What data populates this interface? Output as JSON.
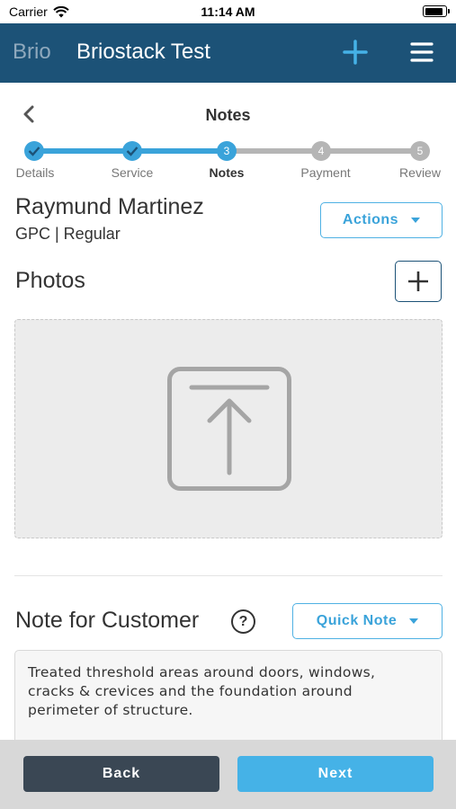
{
  "status_bar": {
    "carrier": "Carrier",
    "time": "11:14 AM",
    "battery_level": 0.9
  },
  "header": {
    "brand": "Brio",
    "title": "Briostack Test",
    "add_icon": "plus-icon",
    "menu_icon": "hamburger-icon"
  },
  "wizard": {
    "title": "Notes",
    "back_icon": "chevron-left-icon",
    "steps": [
      {
        "label": "Details",
        "state": "done"
      },
      {
        "label": "Service",
        "state": "done"
      },
      {
        "label": "Notes",
        "number": "3",
        "state": "active"
      },
      {
        "label": "Payment",
        "number": "4",
        "state": "pending"
      },
      {
        "label": "Review",
        "number": "5",
        "state": "pending"
      }
    ]
  },
  "customer": {
    "name": "Raymund Martinez",
    "subtitle": "GPC | Regular",
    "actions_label": "Actions"
  },
  "photos": {
    "title": "Photos",
    "add_icon": "plus-icon",
    "upload_icon": "upload-icon"
  },
  "note": {
    "title": "Note for Customer",
    "help_symbol": "?",
    "quick_note_label": "Quick Note",
    "lines": [
      "Treated threshold areas around doors, windows,",
      "cracks & crevices and the foundation around",
      "perimeter of structure."
    ]
  },
  "footer": {
    "back_label": "Back",
    "next_label": "Next"
  },
  "colors": {
    "header_bg": "#1c5277",
    "accent": "#45b2e7",
    "step_done": "#3aa3da",
    "step_pending": "#b5b5b5",
    "back_button": "#3a4754"
  }
}
